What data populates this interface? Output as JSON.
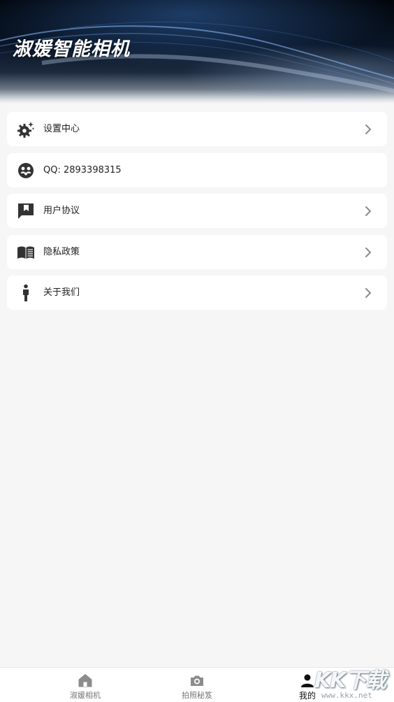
{
  "header": {
    "app_title": "淑媛智能相机"
  },
  "menu": {
    "items": [
      {
        "label": "设置中心",
        "icon": "gear-sparkle-icon",
        "has_chevron": true
      },
      {
        "label": "QQ: 2893398315",
        "icon": "group-icon",
        "has_chevron": false
      },
      {
        "label": "用户协议",
        "icon": "bookmark-chat-icon",
        "has_chevron": true
      },
      {
        "label": "隐私政策",
        "icon": "open-book-icon",
        "has_chevron": true
      },
      {
        "label": "关于我们",
        "icon": "person-icon",
        "has_chevron": true
      }
    ]
  },
  "tabbar": {
    "tabs": [
      {
        "label": "淑媛相机",
        "icon": "home-icon",
        "active": false
      },
      {
        "label": "拍照秘笈",
        "icon": "camera-icon",
        "active": false
      },
      {
        "label": "我的",
        "icon": "person-icon",
        "active": true
      }
    ]
  },
  "watermark": {
    "logo": "KK下载",
    "url": "www.kkx.net"
  },
  "colors": {
    "page_background": "#f6f6f6",
    "card_background": "#ffffff",
    "icon_dark": "#333333",
    "chevron": "#8a8a8a",
    "tab_inactive": "#8c8c8c",
    "tab_active": "#111111"
  }
}
